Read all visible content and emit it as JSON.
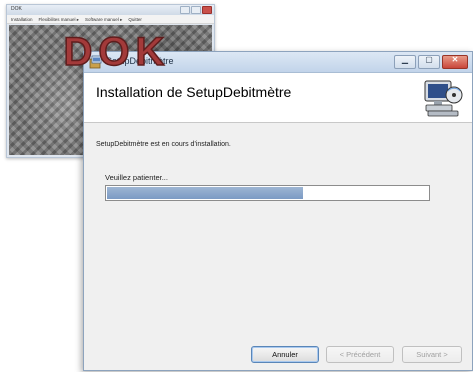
{
  "background_window": {
    "title": "DOK",
    "menu": [
      "Installation",
      "Flexibilites manuel ▸",
      "Software manuel ▸",
      "Quitter"
    ],
    "logo_text": "DOK"
  },
  "dialog": {
    "title": "SetupDebitmètre",
    "heading": "Installation de SetupDebitmètre",
    "status": "SetupDebitmètre est en cours d'installation.",
    "wait_label": "Veuillez patienter...",
    "progress": 0.61,
    "buttons": {
      "cancel": "Annuler",
      "previous": "< Précédent",
      "next": "Suivant >"
    }
  },
  "colors": {
    "progress_fill": "#7b9ac4",
    "titlebar": "#c2d4ea",
    "logo": "#a33a3a"
  },
  "icons": [
    "installer-icon",
    "computer-disc-icon",
    "minimize-icon",
    "maximize-icon",
    "close-icon"
  ]
}
